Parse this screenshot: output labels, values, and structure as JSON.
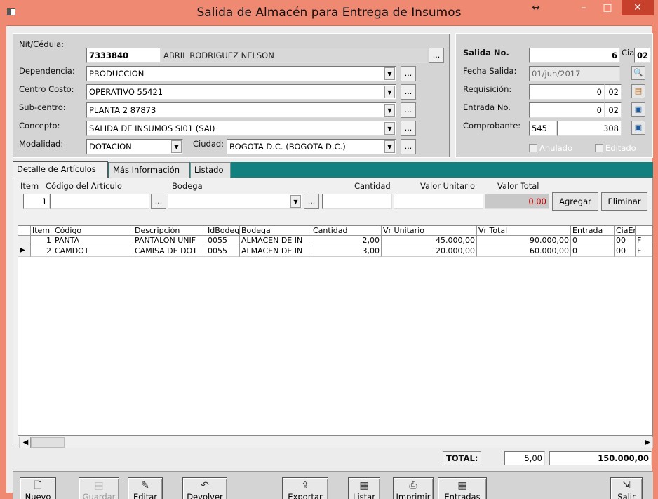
{
  "window": {
    "title": "Salida de Almacén para Entrega de Insumos",
    "resize_glyph": "↔",
    "minimize": "–",
    "maximize": "□",
    "close": "✕"
  },
  "form": {
    "nit_label": "Nit/Cédula:",
    "nit_value": "7333840",
    "name_value": "ABRIL RODRIGUEZ NELSON",
    "dependencia_label": "Dependencia:",
    "dependencia_value": "PRODUCCION",
    "centro_label": "Centro Costo:",
    "centro_value": "OPERATIVO 55421",
    "subcentro_label": "Sub-centro:",
    "subcentro_value": "PLANTA 2 87873",
    "concepto_label": "Concepto:",
    "concepto_value": "SALIDA DE INSUMOS SI01  (SAI)",
    "modalidad_label": "Modalidad:",
    "modalidad_value": "DOTACION",
    "ciudad_label": "Ciudad:",
    "ciudad_value": "BOGOTA D.C.  (BOGOTA D.C.)",
    "dots": "..."
  },
  "salida": {
    "salida_label": "Salida No.",
    "salida_value": "6",
    "cia_label": "Cia:",
    "cia_value": "02",
    "fecha_label": "Fecha Salida:",
    "fecha_value": "01/jun/2017",
    "requisicion_label": "Requisición:",
    "requisicion_value": "0",
    "requisicion_cia": "02",
    "entrada_label": "Entrada No.",
    "entrada_value": "0",
    "entrada_cia": "02",
    "comprobante_label": "Comprobante:",
    "comprobante_tipo": "545",
    "comprobante_value": "308",
    "anulado_label": "Anulado",
    "editado_label": "Editado"
  },
  "tabs": [
    {
      "label": "Detalle de Artículos"
    },
    {
      "label": "Más Información"
    },
    {
      "label": "Listado"
    }
  ],
  "entry": {
    "item_label": "Item",
    "codigo_label": "Código del Artículo",
    "bodega_label": "Bodega",
    "cantidad_label": "Cantidad",
    "valor_unitario_label": "Valor Unitario",
    "valor_total_label": "Valor Total",
    "item_value": "1",
    "valor_total_value": "0.00",
    "agregar_label": "Agregar",
    "eliminar_label": "Eliminar"
  },
  "grid": {
    "columns": [
      "Item",
      "Código",
      "Descripción",
      "IdBodeg",
      "Bodega",
      "Cantidad",
      "Vr Unitario",
      "Vr Total",
      "Entrada",
      "CiaEn"
    ],
    "rows": [
      {
        "item": "1",
        "codigo": "PANTA",
        "descripcion": "PANTALON UNIF",
        "idbodega": "0055",
        "bodega": "ALMACEN DE IN",
        "cantidad": "2,00",
        "vr_unitario": "45.000,00",
        "vr_total": "90.000,00",
        "entrada": "0",
        "ciaent": "00",
        "extra": "F"
      },
      {
        "item": "2",
        "codigo": "CAMDOT",
        "descripcion": "CAMISA DE DOT",
        "idbodega": "0055",
        "bodega": "ALMACEN DE IN",
        "cantidad": "3,00",
        "vr_unitario": "20.000,00",
        "vr_total": "60.000,00",
        "entrada": "0",
        "ciaent": "00",
        "extra": "F"
      }
    ],
    "selected_marker": "▶"
  },
  "totals": {
    "label": "TOTAL:",
    "cantidad": "5,00",
    "valor": "150.000,00"
  },
  "toolbar": {
    "nuevo": "Nuevo",
    "guardar": "Guardar",
    "editar": "Editar",
    "devolver": "Devolver",
    "exportar": "Exportar",
    "listar": "Listar",
    "imprimir": "Imprimir",
    "entradas": "Entradas",
    "salir": "Salir"
  },
  "colors": {
    "titlebar": "#f08972",
    "tabstrip": "#138080",
    "panel": "#d4d4d4"
  }
}
